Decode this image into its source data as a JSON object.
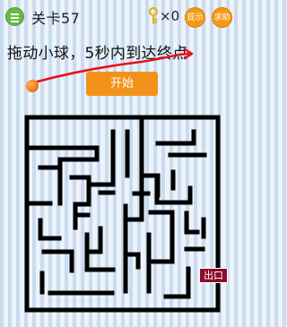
{
  "topbar": {
    "level_label": "关卡57",
    "key_count": "×0",
    "tip_label": "提示",
    "help_label": "求助"
  },
  "instruction": "拖动小球，5秒内到达终点",
  "start_label": "开始",
  "exit_label": "出口",
  "icons": {
    "menu": "menu-icon",
    "key": "key-icon",
    "ball": "ball"
  },
  "colors": {
    "accent_orange": "#f39a17",
    "menu_green": "#66bb47",
    "maze_wall": "#000000",
    "trail_red": "#e8101a",
    "exit_bg": "#8e0d2c"
  }
}
